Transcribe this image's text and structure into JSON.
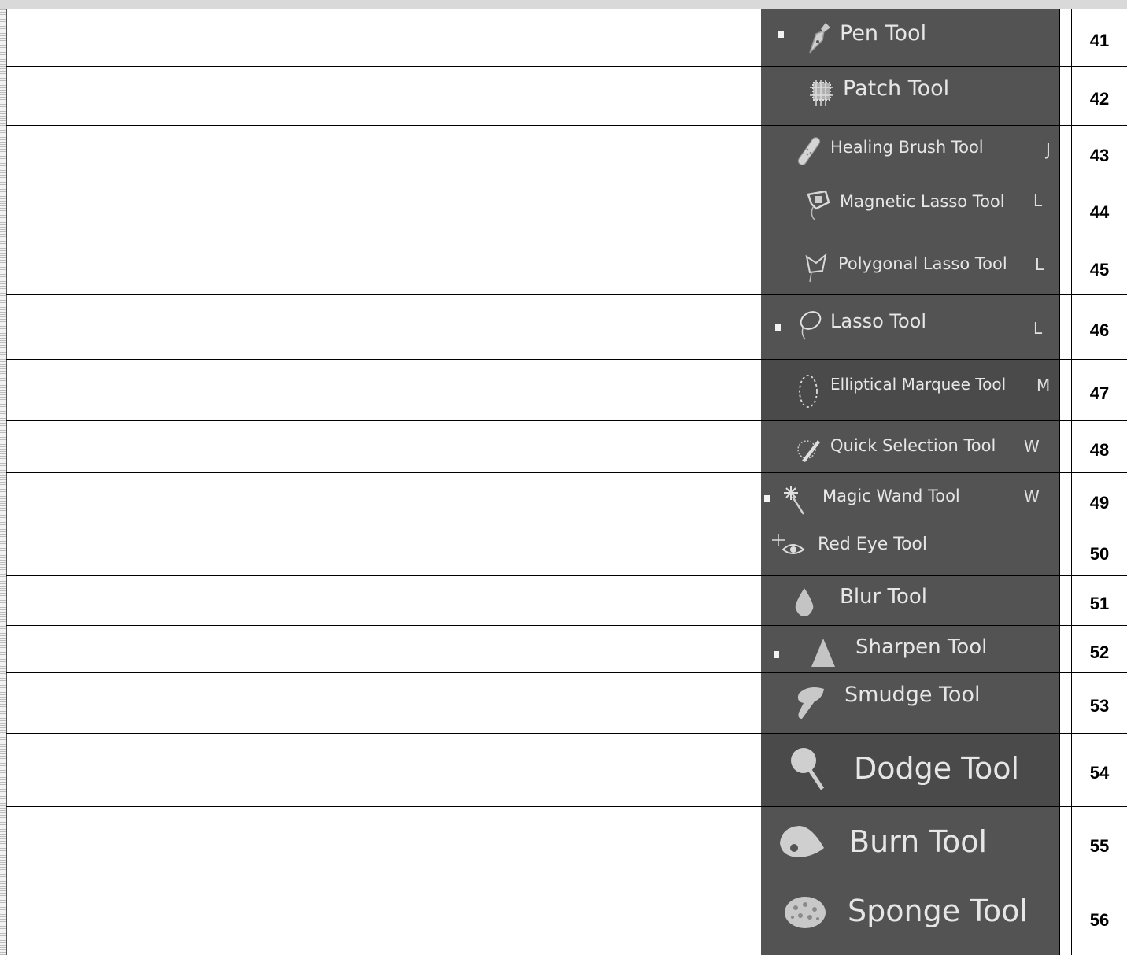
{
  "rows": [
    {
      "number": "41",
      "tool": "Pen Tool",
      "shortcut": "",
      "icon": "pen-icon",
      "selected": true
    },
    {
      "number": "42",
      "tool": "Patch Tool",
      "shortcut": "",
      "icon": "patch-icon",
      "selected": false
    },
    {
      "number": "43",
      "tool": "Healing Brush Tool",
      "shortcut": "J",
      "icon": "healing-brush-icon",
      "selected": false
    },
    {
      "number": "44",
      "tool": "Magnetic Lasso Tool",
      "shortcut": "L",
      "icon": "magnetic-lasso-icon",
      "selected": false
    },
    {
      "number": "45",
      "tool": "Polygonal Lasso Tool",
      "shortcut": "L",
      "icon": "polygonal-lasso-icon",
      "selected": false
    },
    {
      "number": "46",
      "tool": "Lasso Tool",
      "shortcut": "L",
      "icon": "lasso-icon",
      "selected": true
    },
    {
      "number": "47",
      "tool": "Elliptical Marquee Tool",
      "shortcut": "M",
      "icon": "elliptical-marquee-icon",
      "selected": false
    },
    {
      "number": "48",
      "tool": "Quick Selection Tool",
      "shortcut": "W",
      "icon": "quick-selection-icon",
      "selected": false
    },
    {
      "number": "49",
      "tool": "Magic Wand Tool",
      "shortcut": "W",
      "icon": "magic-wand-icon",
      "selected": true
    },
    {
      "number": "50",
      "tool": "Red Eye Tool",
      "shortcut": "",
      "icon": "red-eye-icon",
      "selected": false
    },
    {
      "number": "51",
      "tool": "Blur Tool",
      "shortcut": "",
      "icon": "blur-icon",
      "selected": false
    },
    {
      "number": "52",
      "tool": "Sharpen Tool",
      "shortcut": "",
      "icon": "sharpen-icon",
      "selected": true
    },
    {
      "number": "53",
      "tool": "Smudge Tool",
      "shortcut": "",
      "icon": "smudge-icon",
      "selected": false
    },
    {
      "number": "54",
      "tool": "Dodge Tool",
      "shortcut": "",
      "icon": "dodge-icon",
      "selected": false
    },
    {
      "number": "55",
      "tool": "Burn Tool",
      "shortcut": "",
      "icon": "burn-icon",
      "selected": false
    },
    {
      "number": "56",
      "tool": "Sponge Tool",
      "shortcut": "",
      "icon": "sponge-icon",
      "selected": false
    }
  ],
  "colors": {
    "panel": "#535353",
    "text": "#e6e6e6",
    "grid": "#000000"
  }
}
